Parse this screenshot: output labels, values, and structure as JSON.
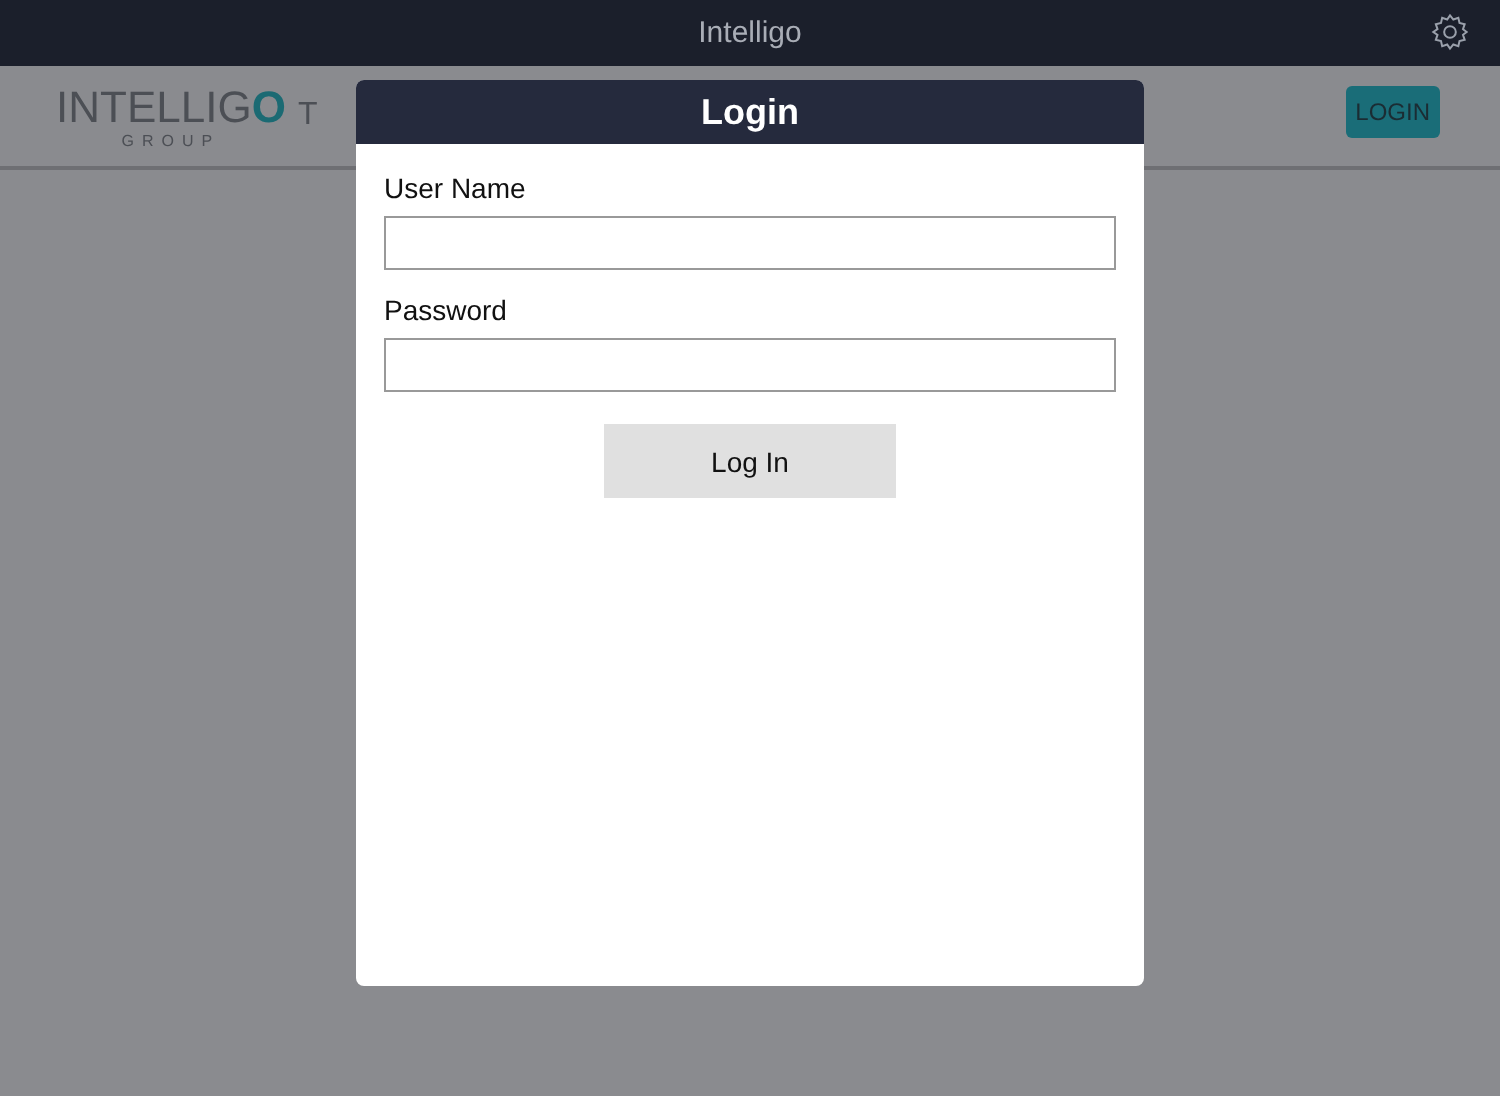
{
  "app_bar": {
    "title": "Intelligo"
  },
  "header": {
    "logo_text": "INTELLIGO",
    "logo_subtext": "GROUP",
    "cut_text": "T",
    "login_button": "LOGIN"
  },
  "dialog": {
    "title": "Login",
    "fields": [
      {
        "label": "User Name"
      },
      {
        "label": "Password"
      }
    ],
    "submit": "Log In"
  }
}
